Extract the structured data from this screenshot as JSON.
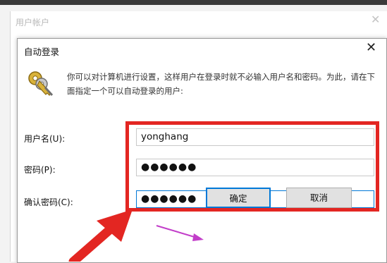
{
  "back_window": {
    "title": "用户帐户",
    "close_glyph": "✕"
  },
  "dialog": {
    "title": "自动登录",
    "close_glyph": "✕",
    "description": "你可以对计算机进行设置，这样用户在登录时就不必输入用户名和密码。为此，请在下面指定一个可以自动登录的用户:"
  },
  "form": {
    "username_label": "用户名(U):",
    "username_value": "yonghang",
    "password_label": "密码(P):",
    "password_value": "●●●●●●",
    "confirm_label": "确认密码(C):",
    "confirm_value": "●●●●●●"
  },
  "buttons": {
    "ok_label": "确定",
    "cancel_label": "取消"
  },
  "icons": {
    "key": "key-icon",
    "close": "close-icon"
  },
  "colors": {
    "accent": "#0078d7",
    "annotation_red": "#e32622",
    "annotation_purple": "#c23ec9"
  }
}
